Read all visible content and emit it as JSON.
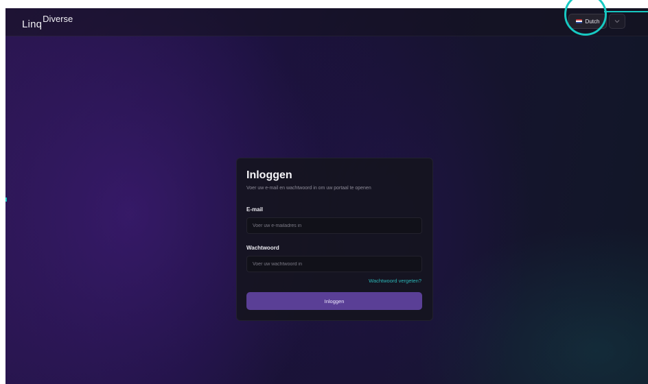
{
  "header": {
    "logo_prefix": "Linq",
    "logo_suffix": "Diverse",
    "language": {
      "flag_icon": "netherlands-flag-icon",
      "label": "Dutch",
      "dropdown_icon": "chevron-down-icon"
    }
  },
  "login": {
    "title": "Inloggen",
    "subtitle": "Voer uw e-mail en wachtwoord in om uw portaal te openen",
    "email_label": "E-mail",
    "email_placeholder": "Voer uw e-mailadres in",
    "email_value": "",
    "password_label": "Wachtwoord",
    "password_placeholder": "Voer uw wachtwoord in",
    "password_value": "",
    "forgot_label": "Wachtwoord vergeten?",
    "submit_label": "Inloggen"
  },
  "colors": {
    "accent_teal": "#17c9c2",
    "button_purple": "#5a3f96",
    "link_teal": "#2bb5b6"
  }
}
